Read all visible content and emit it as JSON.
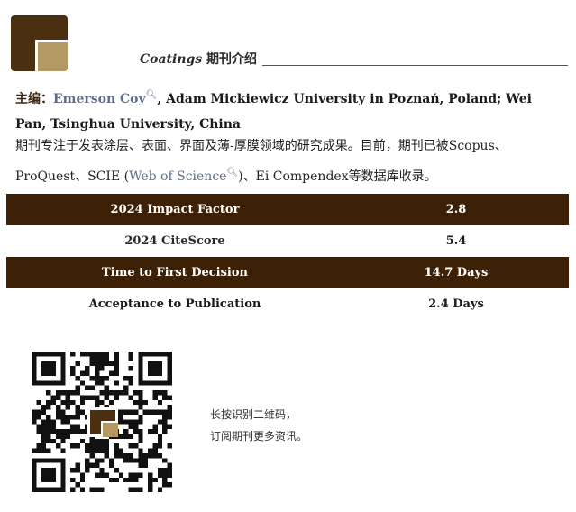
{
  "header": {
    "journal_name": "Coatings",
    "title_suffix": " 期刊介绍"
  },
  "editors": {
    "label": "主编：",
    "primary_editor": "Emerson Coy",
    "primary_affiliation": ", Adam Mickiewicz University in Poznań, Poland; Wei Pan, Tsinghua University, China"
  },
  "description": {
    "text_part1": "期刊专注于发表涂层、表面、界面及薄-厚膜领域的研究成果。目前，期刊已被Scopus、ProQuest、SCIE (",
    "link_text": "Web of Science",
    "text_part2": ")、Ei Compendex等数据库收录。"
  },
  "metrics": [
    {
      "label": "2024 Impact Factor",
      "value": "2.8"
    },
    {
      "label": "2024 CiteScore",
      "value": "5.4"
    },
    {
      "label": "Time to First Decision",
      "value": "14.7 Days"
    },
    {
      "label": "Acceptance to Publication",
      "value": "2.4 Days"
    }
  ],
  "qr": {
    "line1": "长按识别二维码，",
    "line2": "订阅期刊更多资讯。"
  },
  "colors": {
    "brand_dark": "#3c2106",
    "brand_gold": "#b39a63",
    "link": "#5d6c8a"
  },
  "icons": {
    "search": "search-icon",
    "qr": "qr-code-icon"
  }
}
